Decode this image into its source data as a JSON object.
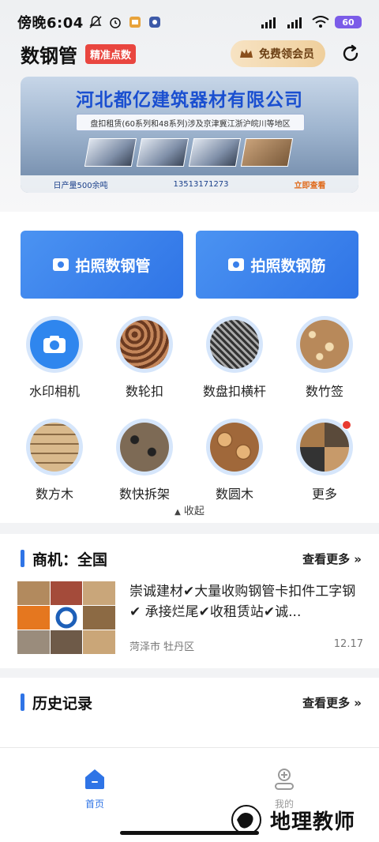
{
  "statusbar": {
    "time": "傍晚6:04",
    "battery": "60"
  },
  "header": {
    "title": "数钢管",
    "tag": "精准点数",
    "vip_label": "免费领会员"
  },
  "banner": {
    "title": "河北都亿建筑器材有限公司",
    "subtitle": "盘扣租赁(60系列和48系列)涉及京津冀江浙沪皖川等地区",
    "output": "日产量500余吨",
    "phone": "13513171273",
    "cta": "立即查看"
  },
  "actions": {
    "photo_pipe": "拍照数钢管",
    "photo_rebar": "拍照数钢筋"
  },
  "grid": {
    "items": [
      {
        "label": "水印相机"
      },
      {
        "label": "数轮扣"
      },
      {
        "label": "数盘扣横杆"
      },
      {
        "label": "数竹签"
      },
      {
        "label": "数方木"
      },
      {
        "label": "数快拆架"
      },
      {
        "label": "数圆木"
      },
      {
        "label": "更多"
      }
    ],
    "collapse_label": "收起"
  },
  "business": {
    "title": "商机：全国",
    "more": "查看更多",
    "item": {
      "text": "崇诚建材✔大量收购钢管卡扣件工字钢✔ 承接烂尾✔收租赁站✔诚...",
      "location": "菏泽市 牡丹区",
      "date": "12.17"
    }
  },
  "history": {
    "title": "历史记录",
    "more": "查看更多"
  },
  "tabbar": {
    "home": "首页",
    "mine": "我的"
  },
  "watermark": {
    "text": "地理教师"
  },
  "colors": {
    "primary": "#2f74e6",
    "tag_red": "#e9463f",
    "vip_gold": "#efcf9c"
  }
}
